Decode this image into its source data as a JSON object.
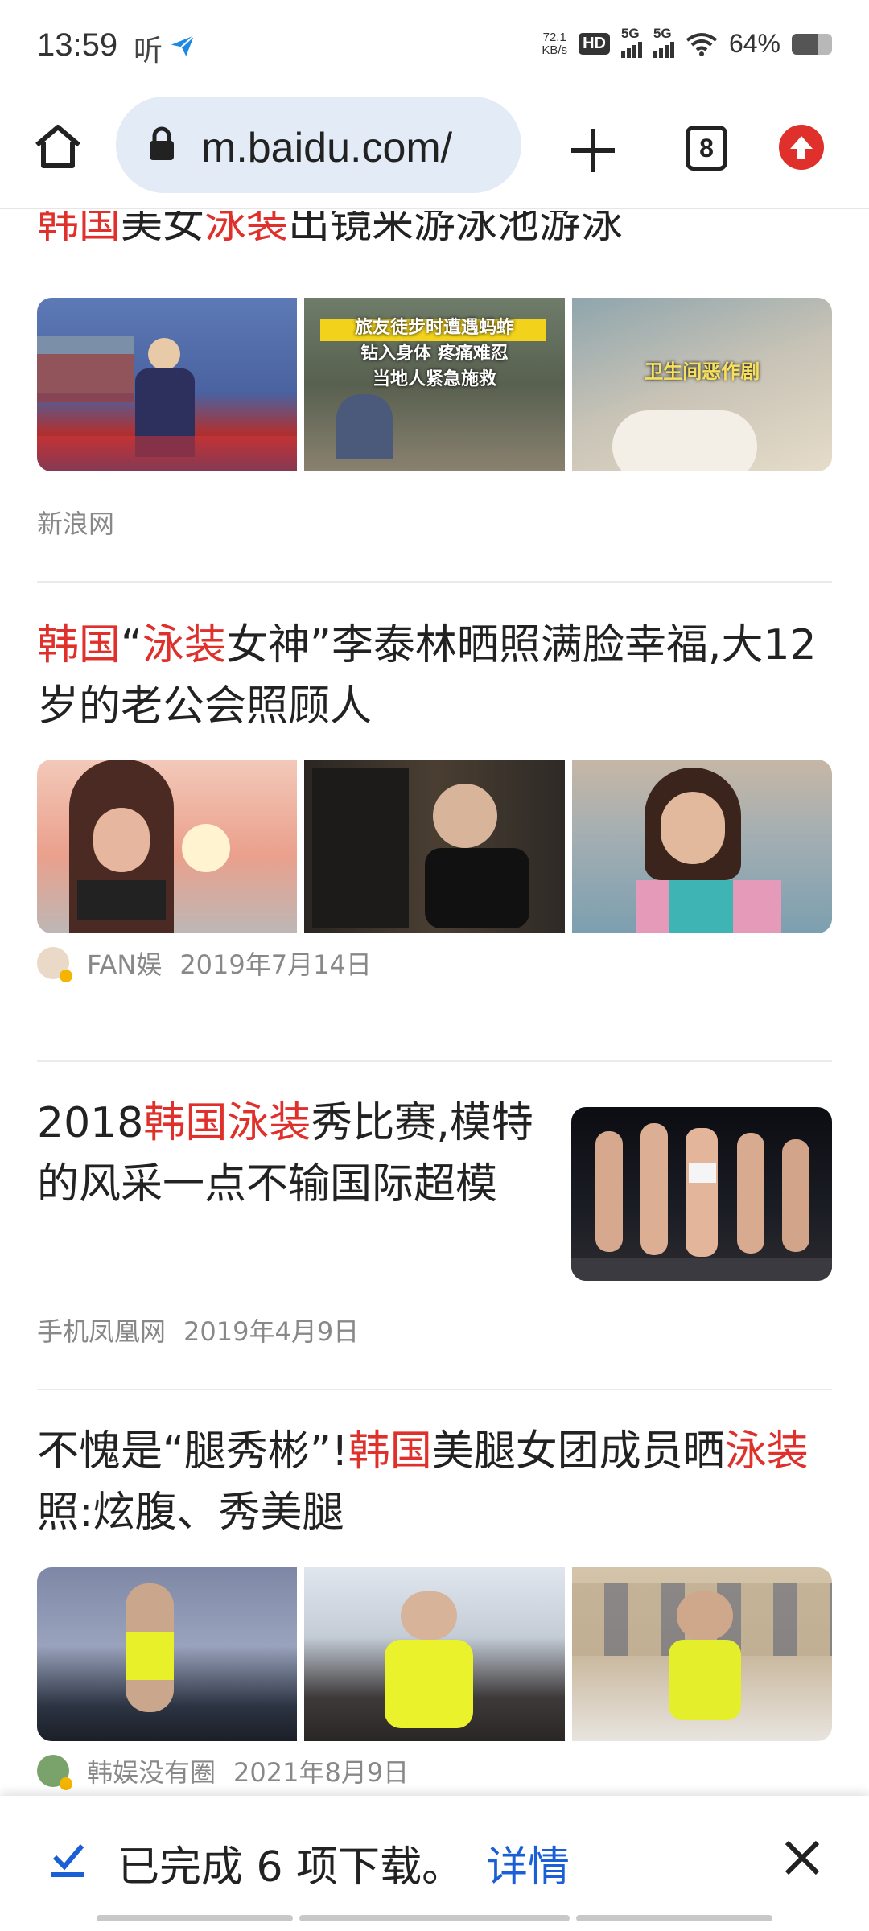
{
  "status_bar": {
    "time": "13:59",
    "ting": "听",
    "net_speed_value": "72.1",
    "net_speed_unit": "KB/s",
    "hd": "HD",
    "sim1": "5G",
    "sim2": "5G",
    "battery_text": "64%",
    "battery_level": 0.64
  },
  "toolbar": {
    "url": "m.baidu.com/",
    "tab_count": "8"
  },
  "results": [
    {
      "title_parts": [
        [
          "韩国",
          true
        ],
        [
          "美女",
          false
        ],
        [
          "泳装",
          true
        ],
        [
          "出镜来游泳池游泳",
          false
        ]
      ],
      "thumb_captions": [
        "",
        "旅友徒步时遭遇蚂蚱\n钻入身体 疼痛难忍\n当地人紧急施救",
        "卫生间恶作剧"
      ],
      "source": "新浪网",
      "date": ""
    },
    {
      "title_parts": [
        [
          "韩国",
          true
        ],
        [
          "“",
          false
        ],
        [
          "泳装",
          true
        ],
        [
          "女神”李泰林晒照满脸幸福,大12岁的老公会照顾人",
          false
        ]
      ],
      "thumb_captions": [
        "",
        "",
        ""
      ],
      "source": "FAN娱",
      "date": "2019年7月14日"
    },
    {
      "title_parts": [
        [
          "2018",
          false
        ],
        [
          "韩国泳装",
          true
        ],
        [
          "秀比赛,模特的风采一点不输国际超模",
          false
        ]
      ],
      "thumb_captions": [
        ""
      ],
      "source": "手机凤凰网",
      "date": "2019年4月9日"
    },
    {
      "title_parts": [
        [
          "不愧是“腿秀彬”!",
          false
        ],
        [
          "韩国",
          true
        ],
        [
          "美腿女团成员晒",
          false
        ],
        [
          "泳装",
          true
        ],
        [
          "照:炫腹、秀美腿",
          false
        ]
      ],
      "thumb_captions": [
        "",
        "",
        ""
      ],
      "source": "韩娱没有圈",
      "date": "2021年8月9日"
    }
  ],
  "download_bar": {
    "message": "已完成 6 项下载。",
    "link": "详情"
  },
  "colors": {
    "highlight": "#e0302b",
    "link": "#1a5fd6",
    "url_bg": "#e3ebf6"
  }
}
